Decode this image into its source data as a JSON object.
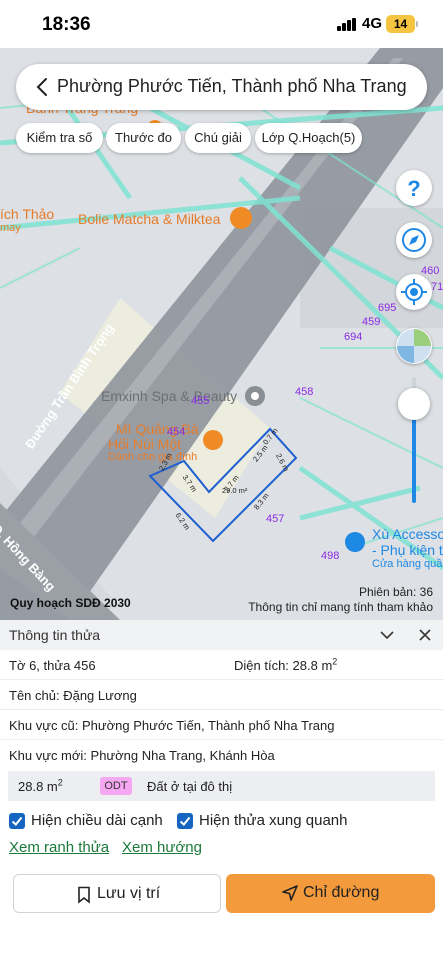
{
  "status_bar": {
    "time": "18:36",
    "network": "4G",
    "battery": "14"
  },
  "map": {
    "title": "Phường Phước Tiến, Thành phố Nha Trang",
    "tools": [
      "Kiểm tra số",
      "Thước đo",
      "Chú giải",
      "Lớp Q.Hoạch(5)"
    ],
    "labels": {
      "poi_top_cut": "Bánh Tráng Trảng",
      "poi_tich_thao": "ích Thảo",
      "poi_tich_thao_sub": "may",
      "poi_bolie": "Bolie Matcha & Milktea",
      "street_tran_binh_trong": "Đường Trần Bình Trọng",
      "street_hong_bang": "Đ. Hồng Bàng",
      "poi_emxinh": "Emxinh Spa & Beauty",
      "poi_mi_quang": "Mì Quảng Bà",
      "poi_mi_quang_2": "Hối Núi Một",
      "poi_mi_quang_sub": "Dành cho gia đình",
      "poi_xu_access": "Xù Accesso",
      "poi_xu_access_2": "- Phụ kiện t",
      "poi_xu_access_3": "Cửa hàng quần"
    },
    "parcel_numbers": [
      "460",
      "71",
      "695",
      "459",
      "694",
      "458",
      "455",
      "454",
      "457",
      "498"
    ],
    "dimensions": [
      "2.3 m",
      "3.7 m",
      "2.7 m",
      "2.5 m",
      "0.7 m",
      "2.6 m",
      "8.3 m",
      "6.2 m"
    ],
    "parcel_area": "29.0 m²",
    "watermark": "Quy hoạch SDĐ 2030",
    "version": "Phiên bản: 36",
    "disclaimer": "Thông tin chỉ mang tính tham khảo",
    "colors": {
      "parcel_outline": "#1e5fd1",
      "grid_lines": "#7fe3d2",
      "road": "#8f959c",
      "accent_blue": "#1e88e5"
    }
  },
  "panel": {
    "title": "Thông tin thửa",
    "sheet_parcel": "Tờ 6, thửa 456",
    "area_label": "Diện tích: 28.8 m",
    "area_sup": "2",
    "owner": "Tên chủ: Đặng Lương",
    "old_area": "Khu vực cũ: Phường Phước Tiến, Thành phố Nha Trang",
    "new_area": "Khu vực mới: Phường Nha Trang, Khánh Hòa",
    "zone": {
      "area": "28.8 m",
      "area_sup": "2",
      "code": "ODT",
      "desc": "Đất ở tại đô thị",
      "code_color": "#f5a7f1"
    },
    "checkbox_lengths": "Hiện chiều dài cạnh",
    "checkbox_neighbors": "Hiện thửa xung quanh",
    "link_boundary": "Xem ranh thửa",
    "link_direction": "Xem hướng",
    "save_button": "Lưu vị trí",
    "directions_button": "Chỉ đường"
  }
}
